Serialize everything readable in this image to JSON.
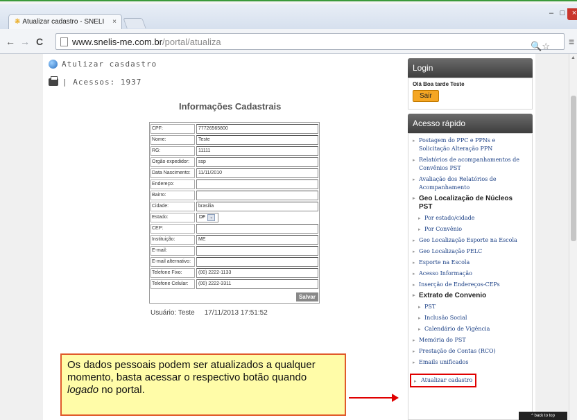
{
  "browser": {
    "tab_title": "Atualizar cadastro - SNELI",
    "tab_close": "×",
    "url_host": "www.snelis-me.com.br",
    "url_path": "/portal/atualiza",
    "window_controls": {
      "minimize": "–",
      "maximize": "□",
      "close": "×"
    },
    "nav": {
      "back": "←",
      "forward": "→",
      "reload": "C",
      "menu": "≡",
      "zoom_star": "🔍☆"
    }
  },
  "page": {
    "breadcrumb": "Atulizar casdastro",
    "access_count": "| Acessos: 1937",
    "form_title": "Informações Cadastrais",
    "fields": [
      {
        "label": "CPF:",
        "value": "77726565800"
      },
      {
        "label": "Nome:",
        "value": "Teste"
      },
      {
        "label": "RG:",
        "value": "11111"
      },
      {
        "label": "Orgão expedidor:",
        "value": "ssp"
      },
      {
        "label": "Data Nascimento:",
        "value": "11/11/2010"
      },
      {
        "label": "Endereço:",
        "value": ""
      },
      {
        "label": "Bairro:",
        "value": ""
      },
      {
        "label": "Cidade:",
        "value": "brasilia"
      },
      {
        "label": "Estado:",
        "value": "DF"
      },
      {
        "label": "CEP:",
        "value": ""
      },
      {
        "label": "Instituição:",
        "value": "ME"
      },
      {
        "label": "E-mail:",
        "value": ""
      },
      {
        "label": "E-mail alternativo:",
        "value": ""
      },
      {
        "label": "Telefone Fixo:",
        "value": "(00) 2222-1133"
      },
      {
        "label": "Telefone Celular:",
        "value": "(00) 2222-3311"
      }
    ],
    "save_label": "Salvar",
    "user_label": "Usuário: Teste",
    "user_datetime": "17/11/2013 17:51:52"
  },
  "sidebar": {
    "login_title": "Login",
    "greeting": "Olá Boa tarde Teste",
    "logout_label": "Sair",
    "quick_title": "Acesso rápido",
    "items": [
      {
        "label": "Postagem do PPC e PPNs e Solicitação Alteração PPN",
        "kind": "link"
      },
      {
        "label": "Relatórios de acompanhamentos de Convênios PST",
        "kind": "link"
      },
      {
        "label": "Avaliação dos Relatórios de Acompanhamento",
        "kind": "link"
      },
      {
        "label": "Geo Localização de Núcleos PST",
        "kind": "major"
      },
      {
        "label": "Por estado/cidade",
        "kind": "sub"
      },
      {
        "label": "Por Convênio",
        "kind": "sub"
      },
      {
        "label": "Geo Localização Esporte na Escola",
        "kind": "link"
      },
      {
        "label": "Geo Localização PELC",
        "kind": "link"
      },
      {
        "label": "Esporte na Escola",
        "kind": "link"
      },
      {
        "label": "Acesso Informação",
        "kind": "link"
      },
      {
        "label": "Inserção de Endereços-CEPs",
        "kind": "link"
      },
      {
        "label": "Extrato de Convenio",
        "kind": "major"
      },
      {
        "label": "PST",
        "kind": "sub"
      },
      {
        "label": "Inclusão Social",
        "kind": "sub"
      },
      {
        "label": "Calendário de Vigência",
        "kind": "sub"
      },
      {
        "label": "Memória do PST",
        "kind": "link"
      },
      {
        "label": "Prestação de Contas (RCO)",
        "kind": "link"
      },
      {
        "label": "Emails unificados",
        "kind": "link"
      }
    ],
    "highlight_item": "Atualizar cadastro",
    "back_to_top": "^ back to top"
  },
  "callout": {
    "text_before": "Os dados pessoais podem ser atualizados a qualquer momento, basta acessar o respectivo botão quando ",
    "text_italic": "logado",
    "text_after": " no portal."
  },
  "colors": {
    "panel_header": "#4a4a4a",
    "logout_button": "#f5a623",
    "link": "#1a3f85",
    "callout_bg": "#fffca8",
    "highlight_border": "#e00000"
  }
}
